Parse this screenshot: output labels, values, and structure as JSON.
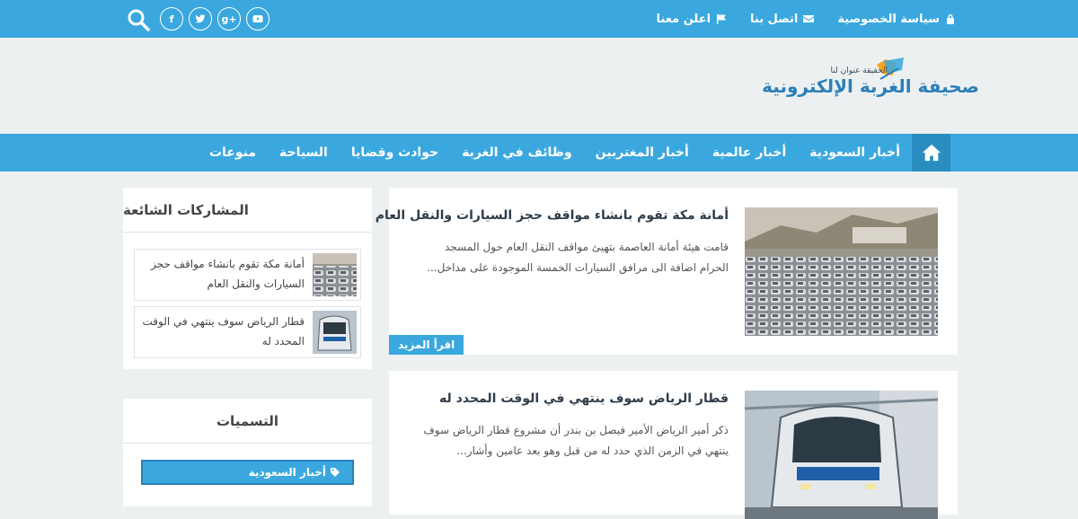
{
  "topbar": {
    "links": [
      {
        "label": "سياسة الخصوصية",
        "icon": "lock-icon"
      },
      {
        "label": "اتصل بنا",
        "icon": "envelope-icon"
      },
      {
        "label": "اعلن معنا",
        "icon": "flag-icon"
      }
    ],
    "socials": [
      {
        "name": "facebook-icon",
        "glyph": "f"
      },
      {
        "name": "twitter-icon",
        "glyph": ""
      },
      {
        "name": "google-plus-icon",
        "glyph": "g+"
      },
      {
        "name": "youtube-icon",
        "glyph": ""
      }
    ]
  },
  "logo": {
    "main": "صحيفة الغربة الإلكترونية",
    "tagline": "الحقيقة عنوان لنا"
  },
  "nav": {
    "items": [
      "أخبار السعودية",
      "أخبار عالمية",
      "أخبار المغتربين",
      "وظائف في الغربة",
      "حوادث وقضايا",
      "السياحة",
      "منوعات"
    ]
  },
  "posts": [
    {
      "title": "أمانة مكة تقوم بانشاء مواقف حجز السيارات والنقل العام",
      "excerpt": "قامت هيئة أمانة العاصمة بتهيئ مواقف النقل العام حول المسجد الحرام اضافة الى مرافق السيارات الخمسة الموجودة على مداخل...",
      "read_more": "اقرأ المزيد"
    },
    {
      "title": "قطار الرياض سوف ينتهي في الوقت المحدد له",
      "excerpt": "ذكر أمير  الرياض الأمير فيصل بن بندر أن مشروع قطار الرياض سوف ينتهي في الزمن الذي حدد له من قبل وهو بعد عامين وأشار..."
    }
  ],
  "sidebar": {
    "popular_title": "المشاركات الشائعة",
    "popular": [
      {
        "title": "أمانة مكة تقوم بانشاء مواقف حجز السيارات والنقل العام"
      },
      {
        "title": "قطار الرياض سوف ينتهي في الوقت المحدد له"
      }
    ],
    "labels_title": "التسميات",
    "labels": [
      "أخبار السعودية"
    ]
  },
  "colors": {
    "accent": "#3aa8de",
    "accent_dark": "#2a8dbf",
    "background": "#ecf0f1",
    "logo_blue": "#2c7fb8",
    "logo_orange": "#f5a623"
  }
}
